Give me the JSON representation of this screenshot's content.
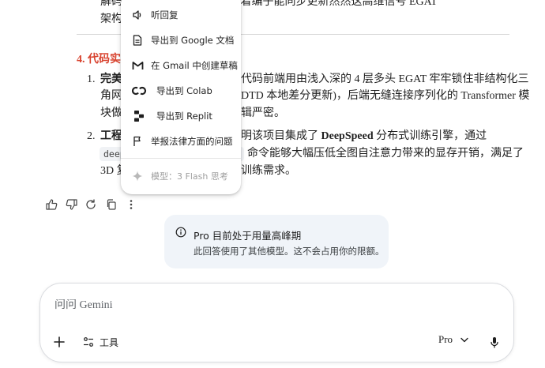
{
  "document": {
    "top_line_1": "解码器… 普通 GAT 的表现量着编子能同步更新然然这高维信号 EGAT",
    "top_line_2": "架构。",
    "section_heading": "4. 代码实现",
    "item1_num": "1.",
    "item1_bold": "完美",
    "item1_line1_rest": "代码前端用由浅入深的 4 层多头 EGAT 牢牢锁住非结构化三",
    "item1_line2_prefix": "角网",
    "item1_line2_rest": "DTD 本地差分更新)，后端无缝连接序列化的 Transformer 模",
    "item1_line3_prefix": "块做",
    "item1_line3_rest": "辑严密。",
    "item2_num": "2.",
    "item2_bold": "工程",
    "item2_line1_rest_a": "明该项目集成了 ",
    "item2_line1_bold": "DeepSpeed",
    "item2_line1_rest_b": " 分布式训练引擎，通过",
    "item2_code": "deep",
    "item2_line2_rest": "命令能够大幅压低全图自注意力带来的显存开销，满足了",
    "item2_line3_prefix": "3D 复",
    "item2_line3_rest": "训练需求。"
  },
  "menu": {
    "items": [
      {
        "label": "听回复",
        "icon": "speaker-icon"
      },
      {
        "label": "导出到 Google 文档",
        "icon": "document-icon"
      },
      {
        "label": "在 Gmail 中创建草稿",
        "icon": "gmail-icon"
      },
      {
        "label": "导出到 Colab",
        "icon": "colab-icon"
      },
      {
        "label": "导出到 Replit",
        "icon": "replit-icon"
      },
      {
        "label": "举报法律方面的问题",
        "icon": "flag-icon"
      }
    ],
    "model_label": "模型：3 Flash 思考"
  },
  "actions": [
    "thumb-up-icon",
    "thumb-down-icon",
    "regenerate-icon",
    "copy-icon",
    "more-vert-icon"
  ],
  "notice": {
    "title": "Pro 目前处于用量高峰期",
    "body": "此回答使用了其他模型。这不会占用你的限额。"
  },
  "composer": {
    "placeholder": "问问 Gemini",
    "tools_label": "工具",
    "model_label": "Pro"
  },
  "colors": {
    "heading": "#d8432f",
    "notice_bg": "#f0f4f9",
    "text": "#1f1f1f"
  }
}
